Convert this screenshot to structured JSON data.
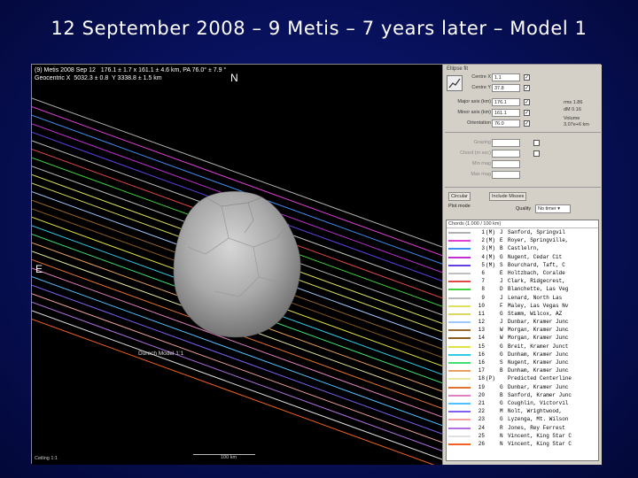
{
  "slide": {
    "title": "12 September 2008 – 9 Metis – 7 years later – Model 1"
  },
  "view": {
    "header_line1": "(9) Metis 2008 Sep 12   176.1 ± 1.7 x 161.1 ± 4.6 km, PA 76.0° ± 7.9 °",
    "header_line2": "Geocentric X  5032.3 ± 0.8  Y 3338.8 ± 1.5 km",
    "north": "N",
    "east": "E",
    "model_label": "Durech Model 1:1",
    "bottom_left": "Ceiling 1:1",
    "scale_label": "100 km"
  },
  "panel": {
    "title": "Ellipse fit",
    "rows": [
      {
        "label": "Centre X",
        "value": "1.1"
      },
      {
        "label": "Centre Y",
        "value": "37.8"
      },
      {
        "label": "Major axis (km)",
        "value": "176.1"
      },
      {
        "label": "Minor axis (km)",
        "value": "161.1"
      },
      {
        "label": "Orientation",
        "value": "76.0"
      }
    ],
    "side": {
      "rms": "rms 1.86",
      "dm": "dM 0.16",
      "volume": "Volume",
      "vol_val": "3.07e+6 km"
    },
    "dim_rows": [
      "Grazing",
      "Chord (m sec)",
      "Min mag",
      "Max mag"
    ],
    "options": {
      "circular": "Circular",
      "include_misses": "Include Misses",
      "plot_mode": "Plot mode",
      "quality": "Quality",
      "quality_value": "No timer"
    },
    "list_header": "Chords (1.000 / 100 km)"
  },
  "chords": [
    {
      "num": "1",
      "tag": "(M)",
      "code": "J",
      "obs": "Sanford, Springvil",
      "color": "#b0b0b0"
    },
    {
      "num": "2",
      "tag": "(M)",
      "code": "E",
      "obs": "Royer, Springville,",
      "color": "#e23fd7"
    },
    {
      "num": "3",
      "tag": "(M)",
      "code": "B",
      "obs": "Castlelrn,",
      "color": "#3f8cf0"
    },
    {
      "num": "4",
      "tag": "(M)",
      "code": "G",
      "obs": "Nugent, Cedar Cit",
      "color": "#c030d0"
    },
    {
      "num": "5",
      "tag": "(M)",
      "code": "S",
      "obs": "Bourchard, Taft, C",
      "color": "#6040e0"
    },
    {
      "num": "6",
      "tag": "",
      "code": "E",
      "obs": "Holtzbach, Coralde",
      "color": "#c0c0c0"
    },
    {
      "num": "7",
      "tag": "",
      "code": "J",
      "obs": "Clark, Ridgecrest,",
      "color": "#e04848"
    },
    {
      "num": "8",
      "tag": "",
      "code": "D",
      "obs": "Blanchette, Las Veg",
      "color": "#40d040"
    },
    {
      "num": "9",
      "tag": "",
      "code": "J",
      "obs": "Lenard, North Las",
      "color": "#b8b8b8"
    },
    {
      "num": "10",
      "tag": "",
      "code": "F",
      "obs": "Maley, Las Vegas Nv",
      "color": "#e0e060"
    },
    {
      "num": "11",
      "tag": "",
      "code": "G",
      "obs": "Stamm, Wilcox, AZ",
      "color": "#d8d860"
    },
    {
      "num": "12",
      "tag": "",
      "code": "J",
      "obs": "Dunbar, Kramer Junc",
      "color": "#a0c8ff"
    },
    {
      "num": "13",
      "tag": "",
      "code": "W",
      "obs": "Morgan, Kramer Junc",
      "color": "#9a6a30"
    },
    {
      "num": "14",
      "tag": "",
      "code": "W",
      "obs": "Morgan, Kramer Junc",
      "color": "#8a5a20"
    },
    {
      "num": "15",
      "tag": "",
      "code": "G",
      "obs": "Breit, Kramer Junct",
      "color": "#e0e040"
    },
    {
      "num": "16",
      "tag": "",
      "code": "G",
      "obs": "Dunham, Kramer Junc",
      "color": "#2ecbe8"
    },
    {
      "num": "16",
      "tag": "",
      "code": "S",
      "obs": "Nugent, Kramer Junc",
      "color": "#40e070"
    },
    {
      "num": "17",
      "tag": "",
      "code": "B",
      "obs": "Dunham, Kramer Junc",
      "color": "#e8a060"
    },
    {
      "num": "18",
      "tag": "(P)",
      "code": "",
      "obs": "Predicted Centerline",
      "color": "#e8e8a0"
    },
    {
      "num": "19",
      "tag": "",
      "code": "G",
      "obs": "Dunbar, Kramer Junc",
      "color": "#e07030"
    },
    {
      "num": "20",
      "tag": "",
      "code": "B",
      "obs": "Sanford, Kramer Junc",
      "color": "#e080c0"
    },
    {
      "num": "21",
      "tag": "",
      "code": "G",
      "obs": "Coughlin, Victorvil",
      "color": "#50c0ff"
    },
    {
      "num": "22",
      "tag": "",
      "code": "M",
      "obs": "Nolt, Wrightwood,",
      "color": "#8060f0"
    },
    {
      "num": "23",
      "tag": "",
      "code": "G",
      "obs": "Lyzenga, Mt. Wilson",
      "color": "#f0a0a0"
    },
    {
      "num": "24",
      "tag": "",
      "code": "R",
      "obs": "Jones, Rey Ferrest",
      "color": "#b070e0"
    },
    {
      "num": "25",
      "tag": "",
      "code": "N",
      "obs": "Vincent, King Star C",
      "color": "#e0e0e0"
    },
    {
      "num": "26",
      "tag": "",
      "code": "N",
      "obs": "Vincent, King Star C",
      "color": "#f06020"
    }
  ]
}
